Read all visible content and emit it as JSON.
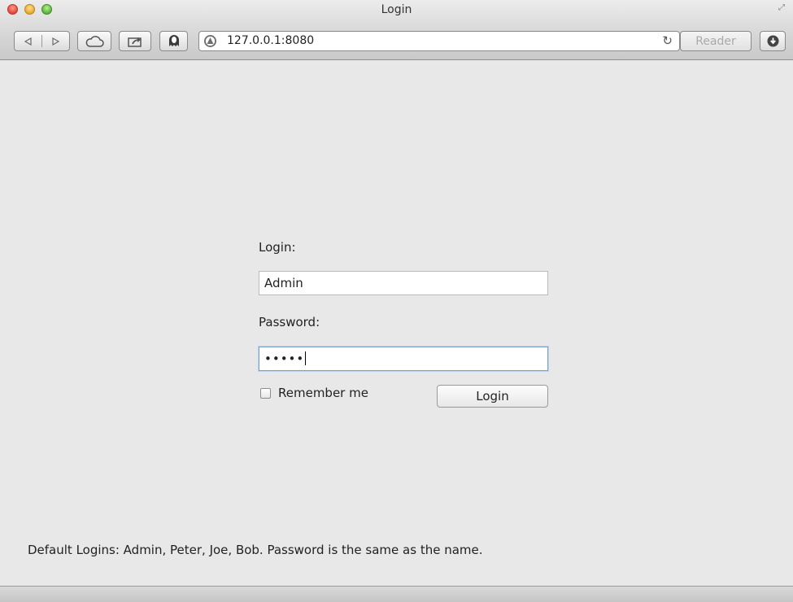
{
  "window": {
    "title": "Login",
    "controls": [
      "close",
      "minimize",
      "zoom"
    ],
    "fullscreen_icon": "fullscreen-arrows-icon"
  },
  "toolbar": {
    "back_icon": "back-arrow-icon",
    "forward_icon": "forward-arrow-icon",
    "icloud_icon": "cloud-icon",
    "share_icon": "share-icon",
    "ghostery_icon": "ghost-icon",
    "url": "127.0.0.1:8080",
    "site_icon": "site-favicon-icon",
    "reload_icon": "reload-icon",
    "reader_label": "Reader",
    "download_icon": "download-icon"
  },
  "form": {
    "login_label": "Login:",
    "login_value": "Admin",
    "password_label": "Password:",
    "password_masked": "•••••",
    "remember_label": "Remember me",
    "remember_checked": false,
    "submit_label": "Login"
  },
  "footer": {
    "note": "Default Logins: Admin, Peter, Joe, Bob. Password is the same as the name."
  },
  "colors": {
    "page_background": "#e8e8e8",
    "focus_border": "#7aa2d4"
  }
}
